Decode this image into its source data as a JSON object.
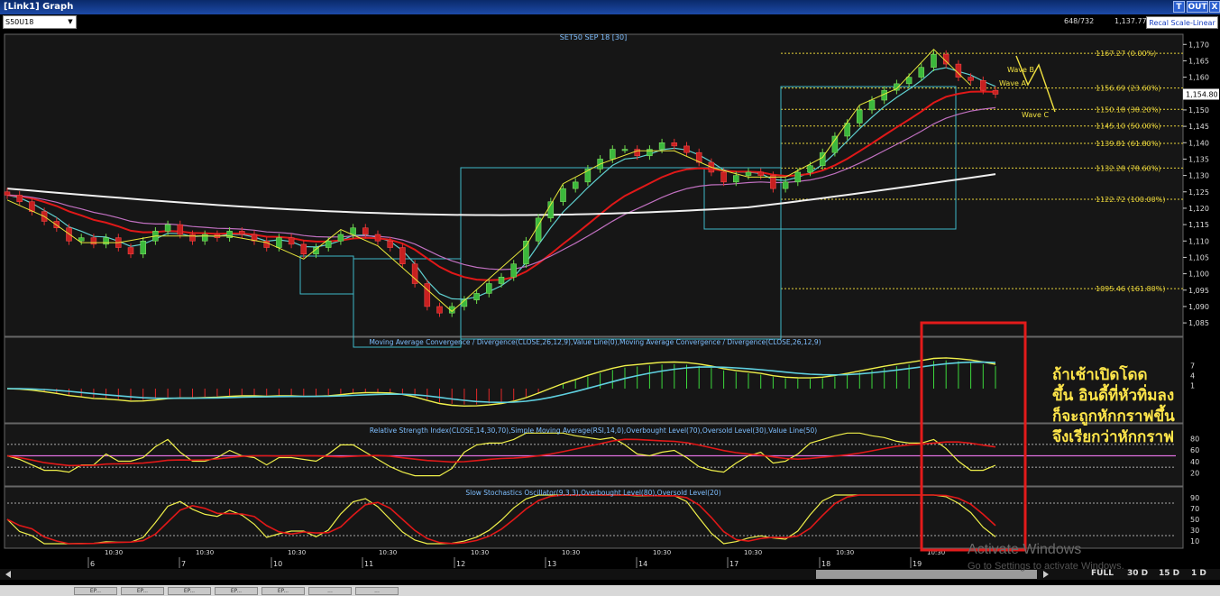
{
  "window": {
    "title": "[Link1] Graph",
    "buttons": [
      "T",
      "OUT",
      "X"
    ]
  },
  "toolbar": {
    "symbol": "S50U18",
    "position": "648/732",
    "price": "1,137.77",
    "scale_button": "Recal Scale-Linear"
  },
  "chart_data": {
    "type": "candlestick",
    "title": "SET50 SEP 18  [30]",
    "current_price_label": "1,154.80",
    "y_ticks": [
      "1,170",
      "1,165",
      "1,160",
      "1,155",
      "1,150",
      "1,145",
      "1,140",
      "1,135",
      "1,130",
      "1,125",
      "1,120",
      "1,115",
      "1,110",
      "1,105",
      "1,100",
      "1,095",
      "1,090",
      "1,085"
    ],
    "ylim": [
      1082,
      1172
    ],
    "x_day_labels": [
      "6",
      "7",
      "10",
      "11",
      "12",
      "13",
      "14",
      "17",
      "18",
      "19"
    ],
    "x_time_label": "10:30",
    "closes": [
      1124,
      1122,
      1119,
      1116,
      1114,
      1110,
      1111,
      1109,
      1111,
      1108,
      1106,
      1110,
      1113,
      1115,
      1112,
      1110,
      1112,
      1111,
      1113,
      1112,
      1110,
      1108,
      1111,
      1109,
      1106,
      1108,
      1110,
      1112,
      1114,
      1112,
      1110,
      1108,
      1103,
      1097,
      1090,
      1088,
      1090,
      1092,
      1094,
      1097,
      1099,
      1103,
      1110,
      1117,
      1122,
      1126,
      1128,
      1132,
      1135,
      1138,
      1138,
      1136,
      1138,
      1140,
      1139,
      1137,
      1134,
      1131,
      1128,
      1130,
      1131,
      1130,
      1126,
      1128,
      1131,
      1133,
      1137,
      1142,
      1146,
      1150,
      1153,
      1156,
      1158,
      1160,
      1163,
      1167,
      1164,
      1160,
      1159,
      1156,
      1154.8
    ],
    "moving_averages": [
      {
        "color": "#5fd0d0",
        "note": "fast MA"
      },
      {
        "color": "#e01818",
        "note": "medium MA"
      },
      {
        "color": "#c070c0",
        "note": "slow MA"
      },
      {
        "color": "#f0f0f0",
        "note": "longest MA"
      }
    ],
    "fibonacci": [
      {
        "label": "1167.27 (0.00%)",
        "value": 1167.27
      },
      {
        "label": "1156.69 (23.60%)",
        "value": 1156.69
      },
      {
        "label": "1150.18 (38.20%)",
        "value": 1150.18
      },
      {
        "label": "1145.10 (50.00%)",
        "value": 1145.1
      },
      {
        "label": "1139.81 (61.80%)",
        "value": 1139.81
      },
      {
        "label": "1132.28 (78.60%)",
        "value": 1132.28
      },
      {
        "label": "1122.72 (100.00%)",
        "value": 1122.72
      },
      {
        "label": "1095.46 (161.80%)",
        "value": 1095.46
      }
    ],
    "wave_labels": [
      "Wave B",
      "Wave A",
      "Wave C"
    ],
    "indicators": [
      {
        "name": "macd",
        "title": "Moving Average Convergence / Divergence(CLOSE,26,12,9),Value Line(0),Moving Average Convergence / Divergence(CLOSE,26,12,9)",
        "y_ticks": [
          "7",
          "4",
          "1"
        ]
      },
      {
        "name": "rsi",
        "title": "Relative Strength Index(CLOSE,14,30,70),Simple Moving Average(RSI,14,0),Overbought Level(70),Oversold Level(30),Value Line(50)",
        "y_ticks": [
          "80",
          "60",
          "40",
          "20"
        ],
        "overbought": 70,
        "oversold": 30
      },
      {
        "name": "stoch",
        "title": "Slow Stochastics Oscillator(9,3,3),Overbought Level(80),Oversold Level(20)",
        "y_ticks": [
          "90",
          "70",
          "50",
          "30",
          "10"
        ],
        "overbought": 80,
        "oversold": 20
      }
    ]
  },
  "annotation": {
    "lines": [
      "ถ้าเช้าเปิดโดด",
      "ขึ้น อินดี้ที่หัวทิ่มลง",
      "ก็จะถูกหักกราฟขึ้น",
      "จึงเรียกว่าหักกราฟ"
    ]
  },
  "navigation": {
    "buttons": [
      "FULL",
      "30 D",
      "15 D",
      "1 D"
    ]
  },
  "watermark": {
    "title": "Activate Windows",
    "subtitle": "Go to Settings to activate Windows."
  },
  "taskbar": {
    "items": [
      "EP...",
      "EP...",
      "EP...",
      "EP...",
      "EP...",
      "...",
      "..."
    ]
  }
}
